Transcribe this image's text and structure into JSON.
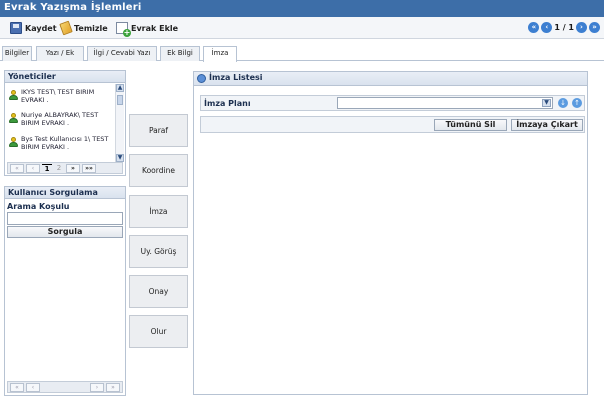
{
  "window": {
    "title": "Evrak Yazışma İşlemleri"
  },
  "toolbar": {
    "save_label": "Kaydet",
    "clean_label": "Temizle",
    "add_doc_label": "Evrak Ekle",
    "pager_text": "1 / 1"
  },
  "tabs": [
    {
      "label": "Bilgiler"
    },
    {
      "label": "Yazı / Ek"
    },
    {
      "label": "İlgi / Cevabi Yazı"
    },
    {
      "label": "Ek Bilgi"
    },
    {
      "label": "İmza"
    }
  ],
  "yoneticiler": {
    "title": "Yöneticiler",
    "items": [
      {
        "text": "IKYS TEST\\ TEST BIRIM EVRAKI ."
      },
      {
        "text": "Nuriye ALBAYRAK\\ TEST BIRIM EVRAKI ."
      },
      {
        "text": "Bys Test Kullanıcısı 1\\ TEST BIRIM EVRAKI ."
      }
    ],
    "pager": {
      "first": "«",
      "prev": "‹",
      "page1": "1",
      "page2": "2",
      "next": "»",
      "last": "»»"
    }
  },
  "kullanici": {
    "title": "Kullanıcı Sorgulama",
    "field_label": "Arama Koşulu",
    "field_value": "",
    "search_button": "Sorgula"
  },
  "actions": {
    "paraf": "Paraf",
    "koordine": "Koordine",
    "imza": "İmza",
    "uy_gorus": "Uy. Görüş",
    "onay": "Onay",
    "olur": "Olur"
  },
  "imza_listesi": {
    "title": "İmza Listesi",
    "plan_label": "İmza Planı",
    "plan_value": "",
    "clear_all": "Tümünü Sil",
    "remove": "İmzaya Çıkart"
  },
  "bottom_pager": {
    "first": "«",
    "prev": "‹",
    "next": "›",
    "last": "»"
  }
}
